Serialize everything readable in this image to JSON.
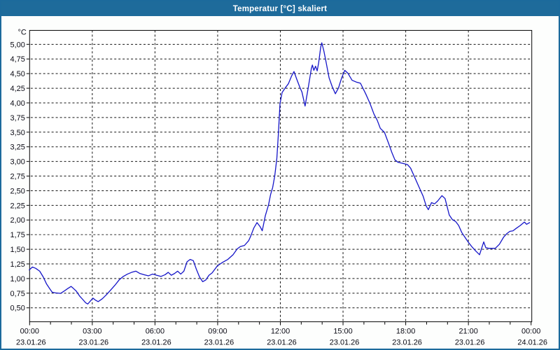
{
  "window": {
    "title": "Temperatur [°C] skaliert"
  },
  "chart_data": {
    "type": "line",
    "title": "Temperatur [°C] skaliert",
    "y_unit_label": "°C",
    "x_label": "",
    "grid": "dashed",
    "legend": "none",
    "colors": {
      "titlebar": "#1e6b9b",
      "window_border": "#1c6a9c",
      "line": "#1414c8",
      "grid": "#141414",
      "plot_border": "#000000",
      "text": "#0a0a14",
      "background": "#fdfefd"
    },
    "y_axis": {
      "min": 0.5,
      "max": 5.0,
      "step": 0.25,
      "ticks": [
        {
          "value": 5.0,
          "label": "5,00"
        },
        {
          "value": 4.75,
          "label": "4,75"
        },
        {
          "value": 4.5,
          "label": "4,50"
        },
        {
          "value": 4.25,
          "label": "4,25"
        },
        {
          "value": 4.0,
          "label": "4,00"
        },
        {
          "value": 3.75,
          "label": "3,75"
        },
        {
          "value": 3.5,
          "label": "3,50"
        },
        {
          "value": 3.25,
          "label": "3,25"
        },
        {
          "value": 3.0,
          "label": "3,00"
        },
        {
          "value": 2.75,
          "label": "2,75"
        },
        {
          "value": 2.5,
          "label": "2,50"
        },
        {
          "value": 2.25,
          "label": "2,25"
        },
        {
          "value": 2.0,
          "label": "2,00"
        },
        {
          "value": 1.75,
          "label": "1,75"
        },
        {
          "value": 1.5,
          "label": "1,50"
        },
        {
          "value": 1.25,
          "label": "1,25"
        },
        {
          "value": 1.0,
          "label": "1,00"
        },
        {
          "value": 0.75,
          "label": "0,75"
        },
        {
          "value": 0.5,
          "label": "0,50"
        }
      ]
    },
    "x_axis": {
      "min_hour": 0,
      "max_hour": 24,
      "minor_step_hours": 1,
      "major_step_hours": 3,
      "ticks": [
        {
          "hour": 0,
          "time": "00:00",
          "date": "23.01.26"
        },
        {
          "hour": 3,
          "time": "03:00",
          "date": "23.01.26"
        },
        {
          "hour": 6,
          "time": "06:00",
          "date": "23.01.26"
        },
        {
          "hour": 9,
          "time": "09:00",
          "date": "23.01.26"
        },
        {
          "hour": 12,
          "time": "12:00",
          "date": "23.01.26"
        },
        {
          "hour": 15,
          "time": "15:00",
          "date": "23.01.26"
        },
        {
          "hour": 18,
          "time": "18:00",
          "date": "23.01.26"
        },
        {
          "hour": 21,
          "time": "21:00",
          "date": "23.01.26"
        },
        {
          "hour": 24,
          "time": "00:00",
          "date": "24.01.26"
        }
      ]
    },
    "series": [
      {
        "name": "Temperatur",
        "points": [
          [
            0,
            1.14
          ],
          [
            0.15,
            1.19
          ],
          [
            0.3,
            1.17
          ],
          [
            0.5,
            1.12
          ],
          [
            0.67,
            1.02
          ],
          [
            0.83,
            0.9
          ],
          [
            1.0,
            0.81
          ],
          [
            1.1,
            0.76
          ],
          [
            1.25,
            0.75
          ],
          [
            1.5,
            0.74
          ],
          [
            1.67,
            0.78
          ],
          [
            1.83,
            0.82
          ],
          [
            2.0,
            0.86
          ],
          [
            2.1,
            0.83
          ],
          [
            2.25,
            0.78
          ],
          [
            2.4,
            0.7
          ],
          [
            2.55,
            0.64
          ],
          [
            2.7,
            0.58
          ],
          [
            2.8,
            0.56
          ],
          [
            2.95,
            0.62
          ],
          [
            3.05,
            0.66
          ],
          [
            3.15,
            0.63
          ],
          [
            3.3,
            0.6
          ],
          [
            3.5,
            0.65
          ],
          [
            3.7,
            0.72
          ],
          [
            3.9,
            0.8
          ],
          [
            4.1,
            0.88
          ],
          [
            4.3,
            0.97
          ],
          [
            4.5,
            1.03
          ],
          [
            4.7,
            1.07
          ],
          [
            4.9,
            1.1
          ],
          [
            5.1,
            1.12
          ],
          [
            5.3,
            1.08
          ],
          [
            5.5,
            1.06
          ],
          [
            5.7,
            1.04
          ],
          [
            5.9,
            1.07
          ],
          [
            6.1,
            1.05
          ],
          [
            6.3,
            1.03
          ],
          [
            6.5,
            1.06
          ],
          [
            6.65,
            1.1
          ],
          [
            6.8,
            1.05
          ],
          [
            6.95,
            1.08
          ],
          [
            7.1,
            1.12
          ],
          [
            7.25,
            1.07
          ],
          [
            7.4,
            1.12
          ],
          [
            7.55,
            1.28
          ],
          [
            7.7,
            1.32
          ],
          [
            7.85,
            1.3
          ],
          [
            8.0,
            1.15
          ],
          [
            8.15,
            1.02
          ],
          [
            8.3,
            0.94
          ],
          [
            8.45,
            0.97
          ],
          [
            8.6,
            1.05
          ],
          [
            8.75,
            1.09
          ],
          [
            9.0,
            1.21
          ],
          [
            9.25,
            1.27
          ],
          [
            9.5,
            1.32
          ],
          [
            9.75,
            1.4
          ],
          [
            9.95,
            1.5
          ],
          [
            10.1,
            1.54
          ],
          [
            10.3,
            1.56
          ],
          [
            10.5,
            1.64
          ],
          [
            10.6,
            1.72
          ],
          [
            10.75,
            1.86
          ],
          [
            10.9,
            1.95
          ],
          [
            11.05,
            1.88
          ],
          [
            11.15,
            1.81
          ],
          [
            11.3,
            2.07
          ],
          [
            11.45,
            2.25
          ],
          [
            11.55,
            2.43
          ],
          [
            11.65,
            2.55
          ],
          [
            11.75,
            2.75
          ],
          [
            11.85,
            3.05
          ],
          [
            11.92,
            3.45
          ],
          [
            12.0,
            3.98
          ],
          [
            12.1,
            4.17
          ],
          [
            12.25,
            4.25
          ],
          [
            12.4,
            4.32
          ],
          [
            12.55,
            4.45
          ],
          [
            12.67,
            4.53
          ],
          [
            12.8,
            4.4
          ],
          [
            12.95,
            4.26
          ],
          [
            13.05,
            4.18
          ],
          [
            13.2,
            3.94
          ],
          [
            13.35,
            4.25
          ],
          [
            13.5,
            4.58
          ],
          [
            13.55,
            4.64
          ],
          [
            13.62,
            4.55
          ],
          [
            13.7,
            4.62
          ],
          [
            13.78,
            4.54
          ],
          [
            13.85,
            4.68
          ],
          [
            13.95,
            4.95
          ],
          [
            14.0,
            5.02
          ],
          [
            14.1,
            4.88
          ],
          [
            14.2,
            4.7
          ],
          [
            14.35,
            4.42
          ],
          [
            14.5,
            4.27
          ],
          [
            14.65,
            4.15
          ],
          [
            14.8,
            4.25
          ],
          [
            14.95,
            4.42
          ],
          [
            15.1,
            4.55
          ],
          [
            15.25,
            4.5
          ],
          [
            15.45,
            4.38
          ],
          [
            15.65,
            4.35
          ],
          [
            15.85,
            4.33
          ],
          [
            16.1,
            4.15
          ],
          [
            16.3,
            3.99
          ],
          [
            16.5,
            3.8
          ],
          [
            16.65,
            3.7
          ],
          [
            16.8,
            3.56
          ],
          [
            17.0,
            3.49
          ],
          [
            17.2,
            3.3
          ],
          [
            17.35,
            3.15
          ],
          [
            17.5,
            3.02
          ],
          [
            17.65,
            2.98
          ],
          [
            17.9,
            2.96
          ],
          [
            18.1,
            2.94
          ],
          [
            18.25,
            2.88
          ],
          [
            18.45,
            2.72
          ],
          [
            18.65,
            2.56
          ],
          [
            18.85,
            2.4
          ],
          [
            19.0,
            2.23
          ],
          [
            19.1,
            2.17
          ],
          [
            19.25,
            2.29
          ],
          [
            19.4,
            2.27
          ],
          [
            19.55,
            2.32
          ],
          [
            19.75,
            2.41
          ],
          [
            19.9,
            2.36
          ],
          [
            20.1,
            2.08
          ],
          [
            20.25,
            2.0
          ],
          [
            20.4,
            1.97
          ],
          [
            20.55,
            1.9
          ],
          [
            20.7,
            1.78
          ],
          [
            20.85,
            1.7
          ],
          [
            21.0,
            1.62
          ],
          [
            21.2,
            1.53
          ],
          [
            21.35,
            1.47
          ],
          [
            21.55,
            1.4
          ],
          [
            21.75,
            1.62
          ],
          [
            21.85,
            1.52
          ],
          [
            22.0,
            1.51
          ],
          [
            22.3,
            1.51
          ],
          [
            22.5,
            1.58
          ],
          [
            22.7,
            1.7
          ],
          [
            22.85,
            1.76
          ],
          [
            23.0,
            1.8
          ],
          [
            23.15,
            1.81
          ],
          [
            23.3,
            1.85
          ],
          [
            23.5,
            1.9
          ],
          [
            23.7,
            1.96
          ],
          [
            23.8,
            1.92
          ],
          [
            23.95,
            1.95
          ]
        ]
      }
    ]
  }
}
